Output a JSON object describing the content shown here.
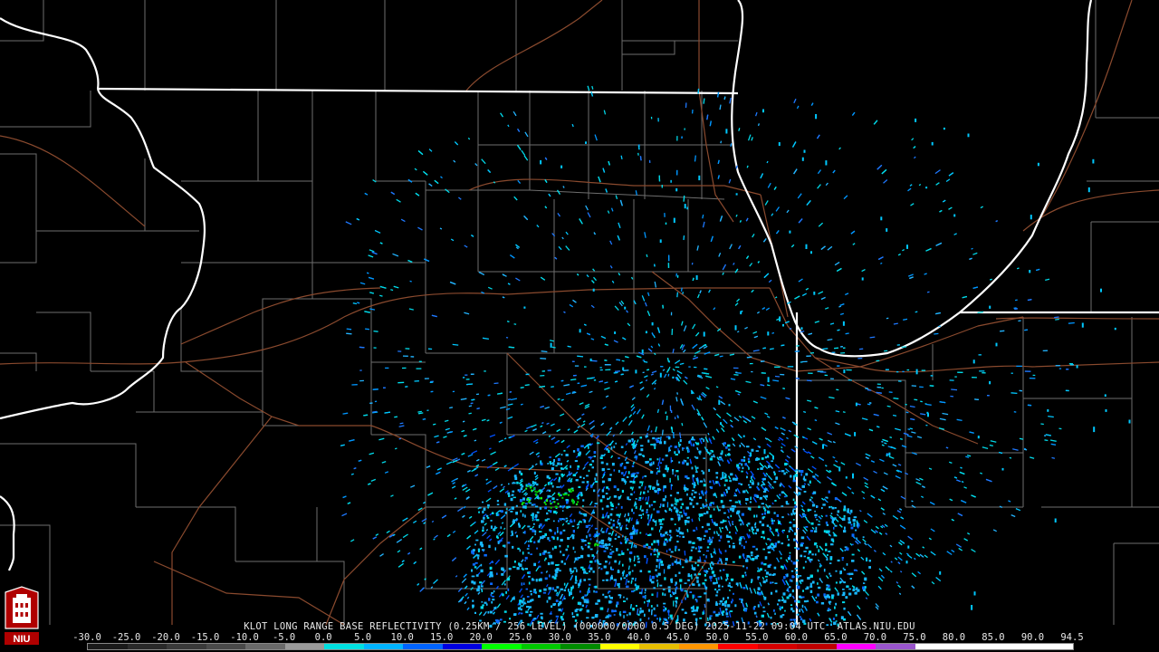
{
  "product_line": "KLOT LONG RANGE BASE REFLECTIVITY (0.25KM / 256 LEVEL) (000000/0000 0.5 DEG) 2025-11-22 09:04 UTC  ATLAS.NIU.EDU",
  "logo_text": "NIU",
  "scale": {
    "labels": [
      "-30.0",
      "-25.0",
      "-20.0",
      "-15.0",
      "-10.0",
      "-5.0",
      "0.0",
      "5.0",
      "10.0",
      "15.0",
      "20.0",
      "25.0",
      "30.0",
      "35.0",
      "40.0",
      "45.0",
      "50.0",
      "55.0",
      "60.0",
      "65.0",
      "70.0",
      "75.0",
      "80.0",
      "85.0",
      "90.0",
      "94.5"
    ],
    "colors": [
      "#1a1a1a",
      "#2a2a2a",
      "#3a3a3a",
      "#4a4a4a",
      "#6a6a6a",
      "#9a9a9a",
      "#00e0e0",
      "#00b4ff",
      "#0064ff",
      "#0000e0",
      "#00ff00",
      "#00c800",
      "#008c00",
      "#ffff00",
      "#e6be00",
      "#ff9600",
      "#ff0000",
      "#d60000",
      "#c00000",
      "#ff00ff",
      "#9955cc",
      "#ffffff",
      "#ffffff",
      "#ffffff",
      "#ffffff"
    ]
  },
  "radar": {
    "site": "KLOT",
    "dominant_dbz_range": [
      0,
      15
    ],
    "green_echoes_present": true
  }
}
